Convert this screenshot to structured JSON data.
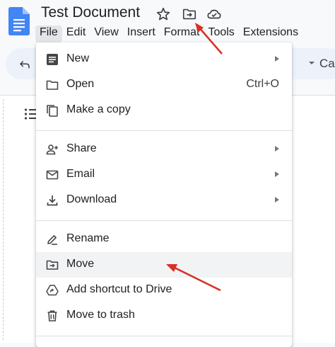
{
  "document": {
    "title": "Test Document"
  },
  "menubar": {
    "items": [
      {
        "label": "File",
        "active": true
      },
      {
        "label": "Edit"
      },
      {
        "label": "View"
      },
      {
        "label": "Insert"
      },
      {
        "label": "Format"
      },
      {
        "label": "Tools"
      },
      {
        "label": "Extensions"
      }
    ]
  },
  "toolbar": {
    "font_partial": "Ca"
  },
  "file_menu": {
    "items": [
      {
        "label": "New",
        "icon": "document-icon",
        "submenu": true
      },
      {
        "label": "Open",
        "icon": "folder-icon",
        "shortcut": "Ctrl+O"
      },
      {
        "label": "Make a copy",
        "icon": "copy-icon"
      },
      {
        "label": "Share",
        "icon": "share-person-icon",
        "submenu": true
      },
      {
        "label": "Email",
        "icon": "email-icon",
        "submenu": true
      },
      {
        "label": "Download",
        "icon": "download-icon",
        "submenu": true
      },
      {
        "label": "Rename",
        "icon": "rename-icon"
      },
      {
        "label": "Move",
        "icon": "move-folder-icon",
        "highlighted": true
      },
      {
        "label": "Add shortcut to Drive",
        "icon": "drive-shortcut-icon"
      },
      {
        "label": "Move to trash",
        "icon": "trash-icon"
      }
    ]
  },
  "colors": {
    "annotation_arrow": "#d93025",
    "docs_blue": "#4285f4"
  }
}
